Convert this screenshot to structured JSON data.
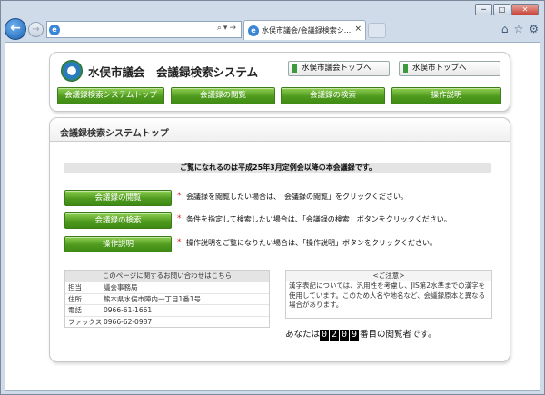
{
  "browser": {
    "back_glyph": "←",
    "forward_glyph": "→",
    "address_value": "",
    "address_tools": "⌕▾→",
    "tab_title": "水俣市議会/会議録検索シ...",
    "tab_close": "×",
    "window_controls": [
      "─",
      "□",
      "✕"
    ],
    "toolbar_icons": [
      "home-icon",
      "star-icon",
      "gear-icon"
    ],
    "toolbar_glyphs": [
      "⌂",
      "☆",
      "⚙"
    ]
  },
  "header": {
    "site_title": "水俣市議会　会議録検索システム",
    "top_links": [
      "水俣市議会トップへ",
      "水俣市トップへ"
    ],
    "global_nav": [
      "会議録検索システムトップ",
      "会議録の閲覧",
      "会議録の検索",
      "操作説明"
    ]
  },
  "main": {
    "title": "会議録検索システムトップ",
    "notice": "ご覧になれるのは平成25年3月定例会以降の本会議録です。",
    "actions": [
      {
        "label": "会議録の閲覧",
        "description": "会議録を閲覧したい場合は、「会議録の閲覧」をクリックください。"
      },
      {
        "label": "会議録の検索",
        "description": "条件を指定して検索したい場合は、「会議録の検索」ボタンをクリックください。"
      },
      {
        "label": "操作説明",
        "description": "操作説明をご覧になりたい場合は、「操作説明」ボタンをクリックください。"
      }
    ],
    "contact": {
      "heading": "このページに関するお問い合わせはこちら",
      "rows": [
        {
          "label": "担当",
          "value": "議会事務局"
        },
        {
          "label": "住所",
          "value": "熊本県水俣市陣内一丁目1番1号"
        },
        {
          "label": "電話",
          "value": "0966-61-1661"
        },
        {
          "label": "ファックス",
          "value": "0966-62-0987"
        }
      ]
    },
    "caution": {
      "heading": "<ご注意>",
      "body": "漢字表記については、汎用性を考慮し、JIS第2水準までの漢字を使用しています。このため人名や地名など、会議録原本と異なる場合があります。"
    },
    "counter": {
      "prefix": "あなたは",
      "digits": [
        "0",
        "2",
        "0",
        "9"
      ],
      "suffix": "番目の閲覧者です。"
    }
  },
  "colors": {
    "nav_green": "#4f9a1e",
    "notice_gray": "#e4e4e4",
    "asterisk_red": "#dd2222"
  }
}
